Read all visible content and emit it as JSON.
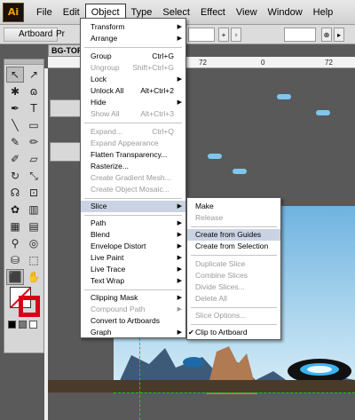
{
  "menubar": {
    "logo": "Ai",
    "items": [
      "File",
      "Edit",
      "Object",
      "Type",
      "Select",
      "Effect",
      "View",
      "Window",
      "Help"
    ],
    "active": "Object"
  },
  "controlbar": {
    "artboard_label": "Artboard",
    "pre_label": "Pr"
  },
  "document": {
    "tab_title": "BG-TOP",
    "ruler_numbers": [
      "72",
      "0",
      "72"
    ]
  },
  "object_menu": {
    "items": [
      {
        "label": "Transform",
        "submenu": true
      },
      {
        "label": "Arrange",
        "submenu": true
      },
      {
        "label": "Group",
        "shortcut": "Ctrl+G"
      },
      {
        "label": "Ungroup",
        "shortcut": "Shift+Ctrl+G",
        "disabled": true
      },
      {
        "label": "Lock",
        "submenu": true
      },
      {
        "label": "Unlock All",
        "shortcut": "Alt+Ctrl+2"
      },
      {
        "label": "Hide",
        "submenu": true
      },
      {
        "label": "Show All",
        "shortcut": "Alt+Ctrl+3",
        "disabled": true
      },
      {
        "label": "Expand...",
        "shortcut": "Ctrl+Q",
        "disabled": true
      },
      {
        "label": "Expand Appearance",
        "disabled": true
      },
      {
        "label": "Flatten Transparency..."
      },
      {
        "label": "Rasterize..."
      },
      {
        "label": "Create Gradient Mesh...",
        "disabled": true
      },
      {
        "label": "Create Object Mosaic...",
        "disabled": true
      },
      {
        "label": "Slice",
        "submenu": true,
        "highlighted": true
      },
      {
        "label": "Path",
        "submenu": true
      },
      {
        "label": "Blend",
        "submenu": true
      },
      {
        "label": "Envelope Distort",
        "submenu": true
      },
      {
        "label": "Live Paint",
        "submenu": true
      },
      {
        "label": "Live Trace",
        "submenu": true
      },
      {
        "label": "Text Wrap",
        "submenu": true
      },
      {
        "label": "Clipping Mask",
        "submenu": true
      },
      {
        "label": "Compound Path",
        "submenu": true,
        "disabled": true
      },
      {
        "label": "Convert to Artboards"
      },
      {
        "label": "Graph",
        "submenu": true
      }
    ]
  },
  "slice_menu": {
    "items": [
      {
        "label": "Make"
      },
      {
        "label": "Release",
        "disabled": true
      },
      {
        "label": "Create from Guides",
        "highlighted": true
      },
      {
        "label": "Create from Selection"
      },
      {
        "label": "Duplicate Slice",
        "disabled": true
      },
      {
        "label": "Combine Slices",
        "disabled": true
      },
      {
        "label": "Divide Slices...",
        "disabled": true
      },
      {
        "label": "Delete All",
        "disabled": true
      },
      {
        "label": "Slice Options...",
        "disabled": true
      },
      {
        "label": "Clip to Artboard",
        "checked": true
      }
    ]
  },
  "colors": {
    "menu_highlight": "#c9d3e3",
    "stroke_red": "#d80018",
    "guide_green": "#18d018"
  }
}
